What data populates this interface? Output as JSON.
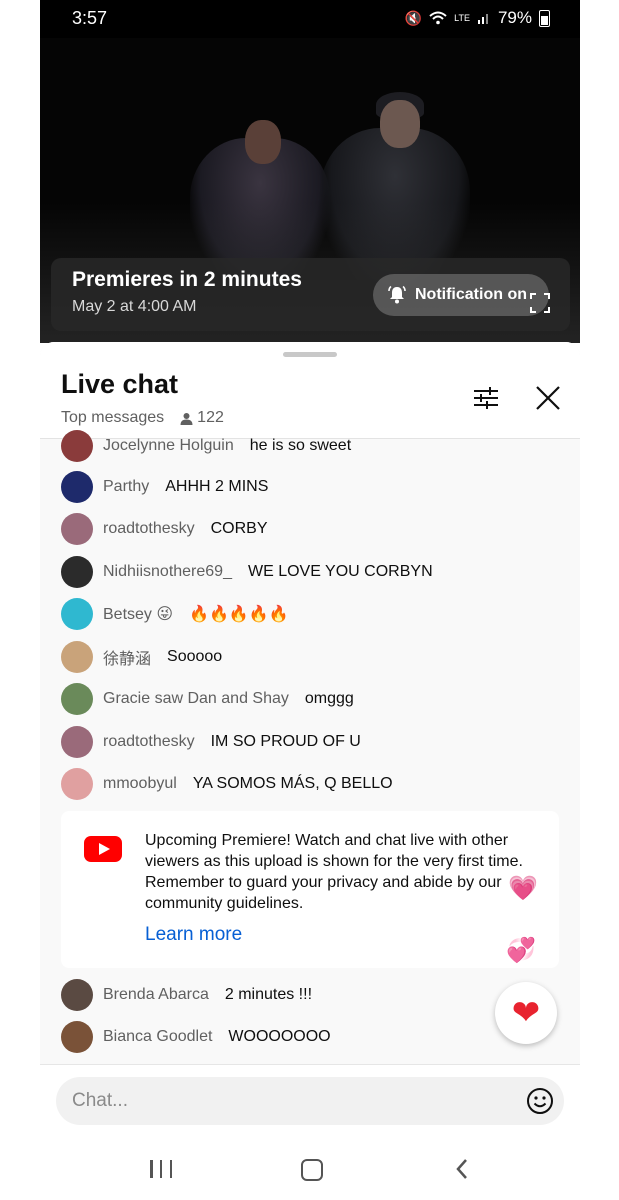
{
  "status_bar": {
    "time": "3:57",
    "battery": "79%",
    "network": "LTE"
  },
  "video": {
    "premiere_title": "Premieres in 2 minutes",
    "premiere_date": "May 2 at 4:00 AM",
    "notification_label": "Notification on"
  },
  "chat_header": {
    "title": "Live chat",
    "mode": "Top messages",
    "viewer_count": "122"
  },
  "messages": [
    {
      "author": "Jocelynne Holguin",
      "text": "he is so sweet",
      "avatar_color": "#8a3b3b"
    },
    {
      "author": "Parthy",
      "text": "AHHH 2 MINS",
      "avatar_color": "#1e2a6b"
    },
    {
      "author": "roadtothesky",
      "text": "CORBY",
      "avatar_color": "#9a6a7a"
    },
    {
      "author": "Nidhiisnothere69_",
      "text": "WE LOVE YOU CORBYN",
      "avatar_color": "#2b2b2b"
    },
    {
      "author": "Betsey 😜",
      "text": "🔥🔥🔥🔥🔥",
      "avatar_color": "#2fb8d0"
    },
    {
      "author": "徐静涵",
      "text": "Sooooo",
      "avatar_color": "#c9a37a"
    },
    {
      "author": "Gracie saw Dan and Shay",
      "text": "omggg",
      "avatar_color": "#6a8a5a"
    },
    {
      "author": "roadtothesky",
      "text": "IM SO PROUD OF U",
      "avatar_color": "#9a6a7a"
    },
    {
      "author": "mmoobyul",
      "text": "YA SOMOS MÁS, Q BELLO",
      "avatar_color": "#e0a0a0"
    },
    {
      "author": "Brenda Abarca",
      "text": "2 minutes !!!",
      "avatar_color": "#5a4a42"
    },
    {
      "author": "Bianca Goodlet",
      "text": "WOOOOOOO",
      "avatar_color": "#7a5238"
    }
  ],
  "notice": {
    "text": "Upcoming Premiere! Watch and chat live with other viewers as this upload is shown for the very first time. Remember to guard your privacy and abide by our community guidelines.",
    "link": "Learn more"
  },
  "chat_input": {
    "placeholder": "Chat..."
  },
  "colors": {
    "youtube_red": "#ff0000",
    "link_blue": "#065fd4",
    "heart_red": "#e8232f"
  }
}
